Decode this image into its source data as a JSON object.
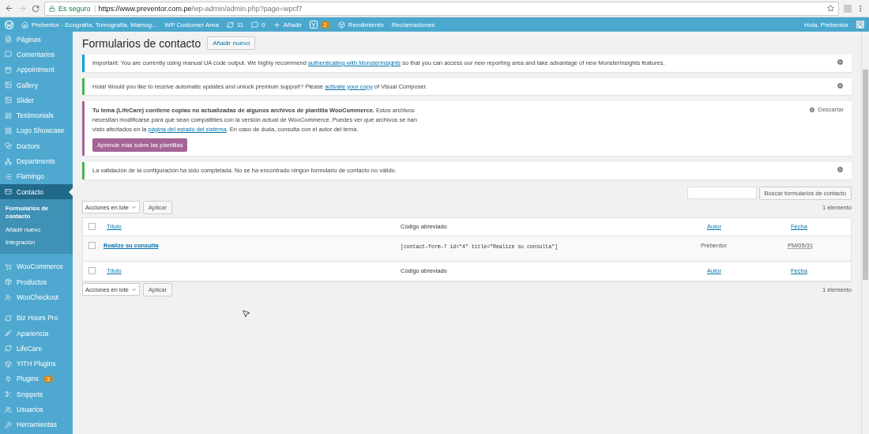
{
  "browser": {
    "secure_label": "Es seguro",
    "url_domain": "https://www.preventor.com.pe",
    "url_path": "/wp-admin/admin.php?page=wpcf7"
  },
  "admin_bar": {
    "items": [
      {
        "kind": "site",
        "label": "Prebentor - Ecografía, Tomografía, Mamog..."
      },
      {
        "kind": "text",
        "label": "WP Customer Area"
      },
      {
        "kind": "updates",
        "label": "11"
      },
      {
        "kind": "comments",
        "label": "0"
      },
      {
        "kind": "add",
        "label": "Añadir"
      },
      {
        "kind": "yoast",
        "badge": "2"
      },
      {
        "kind": "perf",
        "label": "Rendimiento"
      },
      {
        "kind": "text",
        "label": "Reclamaciones"
      }
    ],
    "greeting": "Hola, Prebentor"
  },
  "sidebar": {
    "groups": [
      {
        "items": [
          {
            "label": "Páginas",
            "selected": false
          },
          {
            "label": "Comentarios",
            "selected": false
          },
          {
            "label": "Appointment",
            "selected": false
          },
          {
            "label": "Gallery",
            "selected": false
          },
          {
            "label": "Slider",
            "selected": false
          },
          {
            "label": "Testimonials",
            "selected": false
          },
          {
            "label": "Logo Showcase",
            "selected": false
          },
          {
            "label": "Doctors",
            "selected": false
          },
          {
            "label": "Departments",
            "selected": false
          },
          {
            "label": "Flamingo",
            "selected": false
          },
          {
            "label": "Contacto",
            "selected": true,
            "children": [
              {
                "label": "Formularios de contacto",
                "selected": true
              },
              {
                "label": "Añadir nuevo",
                "selected": false
              },
              {
                "label": "Integración",
                "selected": false
              }
            ]
          }
        ]
      },
      {
        "items": [
          {
            "label": "WooCommerce",
            "selected": false
          },
          {
            "label": "Productos",
            "selected": false
          },
          {
            "label": "WooCheckout",
            "selected": false
          }
        ]
      },
      {
        "items": [
          {
            "label": "Biz Hours Pro",
            "selected": false
          },
          {
            "label": "Apariencia",
            "selected": false
          },
          {
            "label": "LifeCare",
            "selected": false
          },
          {
            "label": "YITH Plugins",
            "selected": false
          },
          {
            "label": "Plugins",
            "selected": false,
            "badge": "3"
          },
          {
            "label": "Snippets",
            "selected": false
          },
          {
            "label": "Usuarios",
            "selected": false
          },
          {
            "label": "Herramientas",
            "selected": false
          }
        ]
      }
    ]
  },
  "page": {
    "title": "Formularios de contacto",
    "add_new": "Añadir nuevo"
  },
  "notices": [
    {
      "kind": "info",
      "parts": [
        {
          "text": "Important: You are currently using manual UA code output. We highly recommend "
        },
        {
          "link": "authenticating with MonsterInsights"
        },
        {
          "text": " so that you can access our new reporting area and take advantage of new MonsterInsights features."
        }
      ]
    },
    {
      "kind": "success",
      "parts": [
        {
          "text": "Hola! Would you like to receive automatic updates and unlock premium support? Please "
        },
        {
          "link": "activate your copy"
        },
        {
          "text": " of Visual Composer."
        }
      ]
    },
    {
      "kind": "woo",
      "parts": [
        {
          "text": "**Tu tema (LifeCare) contiene copias no actualizadas de algunos archivos de plantilla WooCommerce.** Estos archivos necesitan modificarse para que sean compatibles con la versión actual de WooCommerce. Puedes ver qué archivos se han visto afectados en la "
        },
        {
          "link": "página del estado del sistema"
        },
        {
          "text": ". En caso de duda, consulta con el autor del tema."
        }
      ],
      "button": "Aprende más sobre las plantillas",
      "dismiss": "Descartar"
    },
    {
      "kind": "success",
      "parts": [
        {
          "text": "La validación de la configuración ha sido completada. No se ha encontrado ningún formulario de contacto no válido."
        }
      ]
    }
  ],
  "search": {
    "button": "Buscar formularios de contacto"
  },
  "bulk_top": {
    "select": "Acciones en lote",
    "apply": "Aplicar",
    "count": "1 elemento"
  },
  "table": {
    "header": {
      "checked": false,
      "columns": [
        "Título",
        "Código abreviado",
        "Autor",
        "Fecha"
      ]
    },
    "rows": [
      {
        "checked": false,
        "title": "Realize su consulta",
        "shortcode": "[contact-form-7 id=\"4\" title=\"Realize su consulta\"]",
        "author": "Prebentor",
        "date": "PM/05/31"
      }
    ],
    "footer": {
      "checked": false,
      "columns": [
        "Título",
        "Código abreviado",
        "Autor",
        "Fecha"
      ]
    }
  },
  "bulk_bottom": {
    "select": "Acciones en lote",
    "apply": "Aplicar",
    "count": "1 elemento"
  }
}
